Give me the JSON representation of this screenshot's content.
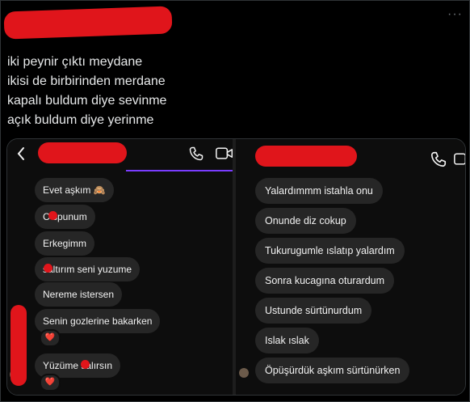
{
  "tweet": {
    "more_label": "···",
    "lines": [
      "iki peynir çıktı meydane",
      "ikisi de birbirinden merdane",
      "kapalı buldum diye sevinme",
      "açık buldum diye yerinme"
    ]
  },
  "left_chat": {
    "back_icon": "chevron-left-icon",
    "call_icon": "phone-icon",
    "video_icon": "video-camera-icon",
    "messages": [
      {
        "text": "Evet aşkım 🙈"
      },
      {
        "text": "C  spunum"
      },
      {
        "text": "Erkegimm"
      },
      {
        "text": "  saltırım seni yuzume"
      },
      {
        "text": "Nereme istersen"
      },
      {
        "text": "Senin gozlerine bakarken",
        "reaction": "❤️"
      },
      {
        "text": "Yüzüme   salırsın",
        "reaction": "❤️"
      }
    ]
  },
  "right_chat": {
    "call_icon": "phone-icon",
    "video_icon": "video-camera-icon",
    "messages": [
      {
        "text": "Yalardımmm istahla onu"
      },
      {
        "text": "Onunde diz cokup"
      },
      {
        "text": "Tukurugumle ıslatıp yalardım"
      },
      {
        "text": "Sonra kucagına oturardum"
      },
      {
        "text": "Ustunde sürtünurdum"
      },
      {
        "text": "Islak ıslak"
      },
      {
        "text": "Öpüşürdük aşkım sürtünürken"
      }
    ]
  },
  "colors": {
    "redaction": "#e0151b",
    "bubble": "#262626",
    "accent": "#7a3cff"
  }
}
